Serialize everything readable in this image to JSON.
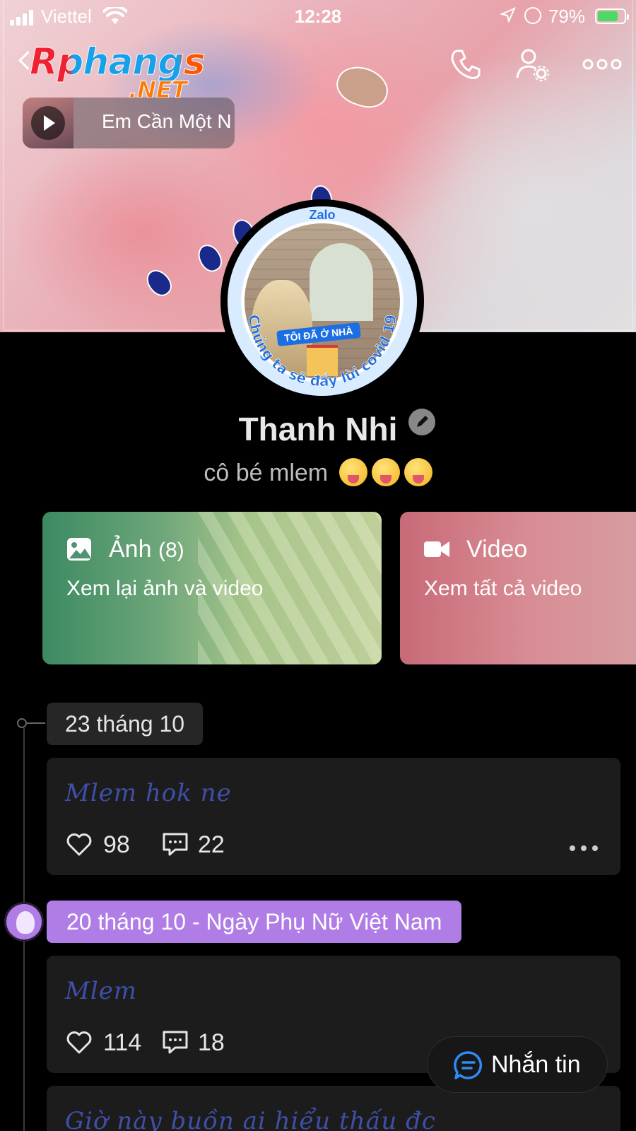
{
  "status_bar": {
    "carrier": "Viettel",
    "time": "12:28",
    "battery_percent": "79%",
    "battery_level": 0.79,
    "icons": [
      "signal-icon",
      "wifi-icon",
      "location-icon",
      "rotation-lock-icon",
      "battery-charging-icon"
    ]
  },
  "watermark": {
    "brand": "Rphangs",
    "suffix": ".NET"
  },
  "header": {
    "icons": [
      "back-icon",
      "phone-icon",
      "profile-settings-icon",
      "more-icon"
    ]
  },
  "music": {
    "title": "Em Cần Một N"
  },
  "avatar": {
    "frame_label": "Zalo",
    "badge": "TÔI ĐÃ Ở NHÀ",
    "arc_text": "Chúng ta sẽ đẩy lùi covid 19"
  },
  "profile": {
    "name": "Thanh Nhi",
    "bio": "cô bé mlem"
  },
  "albums": {
    "photos": {
      "title": "Ảnh",
      "count": "(8)",
      "subtitle": "Xem lại ảnh và video",
      "color": "#3c8a62"
    },
    "video": {
      "title": "Video",
      "subtitle": "Xem tất cả video",
      "color": "#c86a78"
    }
  },
  "timeline": {
    "groups": [
      {
        "date": "23 tháng 10",
        "post": {
          "caption": "Mlem hok ne",
          "likes": "98",
          "comments": "22"
        }
      },
      {
        "date": "20 tháng 10 - Ngày Phụ Nữ Việt Nam",
        "special_color": "#b07de6",
        "post": {
          "caption": "Mlem",
          "likes": "114",
          "comments": "18"
        }
      }
    ],
    "partial_post_caption": "Giờ này buồn ai hiểu thấu đc"
  },
  "message_button": {
    "label": "Nhắn tin",
    "accent": "#2f8cf6"
  }
}
